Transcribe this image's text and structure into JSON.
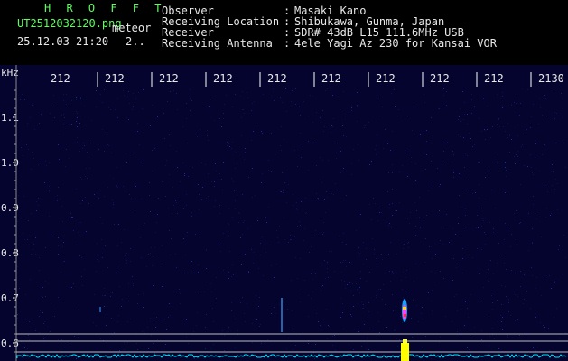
{
  "header": {
    "app_name": "H R O F F T",
    "file_name": "UT2512032120.png",
    "subtitle": "meteor",
    "datetime": "25.12.03 21:20",
    "counter": "2.."
  },
  "info": [
    {
      "label": "Observer",
      "value": "Masaki Kano"
    },
    {
      "label": "Receiving Location",
      "value": "Shibukawa, Gunma, Japan"
    },
    {
      "label": "Receiver",
      "value": "SDR# 43dB L15 111.6MHz USB"
    },
    {
      "label": "Receiving Antenna",
      "value": "4ele Yagi Az 230 for Kansai VOR"
    }
  ],
  "colon": ":",
  "chart_data": {
    "type": "heatmap",
    "ylabel": "kHz",
    "x_ticks": [
      "212",
      "212",
      "212",
      "212",
      "212",
      "212",
      "212",
      "212",
      "212",
      "2130"
    ],
    "y_ticks": [
      "1.1",
      "1.0",
      "0.9",
      "0.8",
      "0.7",
      "0.6"
    ],
    "colors": {
      "background": "#04042e",
      "signal": "#ffff00",
      "trace": "#00e5ff",
      "meteor": "#ff4040",
      "ref_line": "#c0c0c0"
    }
  }
}
